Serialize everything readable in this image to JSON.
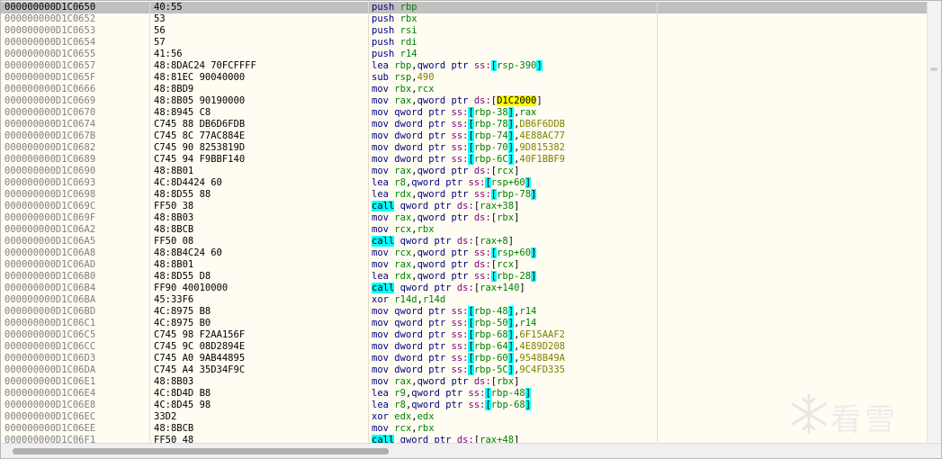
{
  "selected_index": 0,
  "rows": [
    {
      "addr": "000000000D1C0650",
      "bytes": "40:55",
      "mn": "push",
      "ops": [
        [
          "r",
          "rbp"
        ]
      ]
    },
    {
      "addr": "000000000D1C0652",
      "bytes": "53",
      "mn": "push",
      "ops": [
        [
          "r",
          "rbx"
        ]
      ]
    },
    {
      "addr": "000000000D1C0653",
      "bytes": "56",
      "mn": "push",
      "ops": [
        [
          "r",
          "rsi"
        ]
      ]
    },
    {
      "addr": "000000000D1C0654",
      "bytes": "57",
      "mn": "push",
      "ops": [
        [
          "r",
          "rdi"
        ]
      ]
    },
    {
      "addr": "000000000D1C0655",
      "bytes": "41:56",
      "mn": "push",
      "ops": [
        [
          "r",
          "r14"
        ]
      ]
    },
    {
      "addr": "000000000D1C0657",
      "bytes": "48:8DAC24 70FCFFFF",
      "mn": "lea",
      "ops": [
        [
          "r",
          "rbp"
        ],
        [
          "o",
          ","
        ],
        [
          "k",
          "qword ptr "
        ],
        [
          "s",
          "ss:"
        ],
        [
          "b",
          "["
        ],
        [
          "r",
          "rsp-390"
        ],
        [
          "b",
          "]"
        ]
      ]
    },
    {
      "addr": "000000000D1C065F",
      "bytes": "48:81EC 90040000",
      "mn": "sub",
      "ops": [
        [
          "r",
          "rsp"
        ],
        [
          "o",
          ","
        ],
        [
          "n",
          "490"
        ]
      ]
    },
    {
      "addr": "000000000D1C0666",
      "bytes": "48:8BD9",
      "mn": "mov",
      "ops": [
        [
          "r",
          "rbx"
        ],
        [
          "o",
          ","
        ],
        [
          "r",
          "rcx"
        ]
      ]
    },
    {
      "addr": "000000000D1C0669",
      "bytes": "48:8B05 90190000",
      "mn": "mov",
      "ops": [
        [
          "r",
          "rax"
        ],
        [
          "o",
          ","
        ],
        [
          "k",
          "qword ptr "
        ],
        [
          "s",
          "ds:"
        ],
        [
          "o",
          "["
        ],
        [
          "h",
          "D1C2000"
        ],
        [
          "o",
          "]"
        ]
      ]
    },
    {
      "addr": "000000000D1C0670",
      "bytes": "48:8945 C8",
      "mn": "mov",
      "ops": [
        [
          "k",
          "qword ptr "
        ],
        [
          "s",
          "ss:"
        ],
        [
          "b",
          "["
        ],
        [
          "r",
          "rbp-38"
        ],
        [
          "b",
          "]"
        ],
        [
          "o",
          ","
        ],
        [
          "r",
          "rax"
        ]
      ]
    },
    {
      "addr": "000000000D1C0674",
      "bytes": "C745 88 DB6D6FDB",
      "mn": "mov",
      "ops": [
        [
          "k",
          "dword ptr "
        ],
        [
          "s",
          "ss:"
        ],
        [
          "b",
          "["
        ],
        [
          "r",
          "rbp-78"
        ],
        [
          "b",
          "]"
        ],
        [
          "o",
          ","
        ],
        [
          "n",
          "DB6F6DDB"
        ]
      ]
    },
    {
      "addr": "000000000D1C067B",
      "bytes": "C745 8C 77AC884E",
      "mn": "mov",
      "ops": [
        [
          "k",
          "dword ptr "
        ],
        [
          "s",
          "ss:"
        ],
        [
          "b",
          "["
        ],
        [
          "r",
          "rbp-74"
        ],
        [
          "b",
          "]"
        ],
        [
          "o",
          ","
        ],
        [
          "n",
          "4E88AC77"
        ]
      ]
    },
    {
      "addr": "000000000D1C0682",
      "bytes": "C745 90 8253819D",
      "mn": "mov",
      "ops": [
        [
          "k",
          "dword ptr "
        ],
        [
          "s",
          "ss:"
        ],
        [
          "b",
          "["
        ],
        [
          "r",
          "rbp-70"
        ],
        [
          "b",
          "]"
        ],
        [
          "o",
          ","
        ],
        [
          "n",
          "9D815382"
        ]
      ]
    },
    {
      "addr": "000000000D1C0689",
      "bytes": "C745 94 F9BBF140",
      "mn": "mov",
      "ops": [
        [
          "k",
          "dword ptr "
        ],
        [
          "s",
          "ss:"
        ],
        [
          "b",
          "["
        ],
        [
          "r",
          "rbp-6C"
        ],
        [
          "b",
          "]"
        ],
        [
          "o",
          ","
        ],
        [
          "n",
          "40F1BBF9"
        ]
      ]
    },
    {
      "addr": "000000000D1C0690",
      "bytes": "48:8B01",
      "mn": "mov",
      "ops": [
        [
          "r",
          "rax"
        ],
        [
          "o",
          ","
        ],
        [
          "k",
          "qword ptr "
        ],
        [
          "s",
          "ds:"
        ],
        [
          "o",
          "["
        ],
        [
          "r",
          "rcx"
        ],
        [
          "o",
          "]"
        ]
      ]
    },
    {
      "addr": "000000000D1C0693",
      "bytes": "4C:8D4424 60",
      "mn": "lea",
      "ops": [
        [
          "r",
          "r8"
        ],
        [
          "o",
          ","
        ],
        [
          "k",
          "qword ptr "
        ],
        [
          "s",
          "ss:"
        ],
        [
          "b",
          "["
        ],
        [
          "r",
          "rsp+60"
        ],
        [
          "b",
          "]"
        ]
      ]
    },
    {
      "addr": "000000000D1C0698",
      "bytes": "48:8D55 88",
      "mn": "lea",
      "ops": [
        [
          "r",
          "rdx"
        ],
        [
          "o",
          ","
        ],
        [
          "k",
          "qword ptr "
        ],
        [
          "s",
          "ss:"
        ],
        [
          "b",
          "["
        ],
        [
          "r",
          "rbp-78"
        ],
        [
          "b",
          "]"
        ]
      ]
    },
    {
      "addr": "000000000D1C069C",
      "bytes": "FF50 38",
      "mn": "call",
      "ops": [
        [
          "k",
          "qword ptr "
        ],
        [
          "s",
          "ds:"
        ],
        [
          "o",
          "["
        ],
        [
          "r",
          "rax+38"
        ],
        [
          "o",
          "]"
        ]
      ]
    },
    {
      "addr": "000000000D1C069F",
      "bytes": "48:8B03",
      "mn": "mov",
      "ops": [
        [
          "r",
          "rax"
        ],
        [
          "o",
          ","
        ],
        [
          "k",
          "qword ptr "
        ],
        [
          "s",
          "ds:"
        ],
        [
          "o",
          "["
        ],
        [
          "r",
          "rbx"
        ],
        [
          "o",
          "]"
        ]
      ]
    },
    {
      "addr": "000000000D1C06A2",
      "bytes": "48:8BCB",
      "mn": "mov",
      "ops": [
        [
          "r",
          "rcx"
        ],
        [
          "o",
          ","
        ],
        [
          "r",
          "rbx"
        ]
      ]
    },
    {
      "addr": "000000000D1C06A5",
      "bytes": "FF50 08",
      "mn": "call",
      "ops": [
        [
          "k",
          "qword ptr "
        ],
        [
          "s",
          "ds:"
        ],
        [
          "o",
          "["
        ],
        [
          "r",
          "rax+8"
        ],
        [
          "o",
          "]"
        ]
      ]
    },
    {
      "addr": "000000000D1C06A8",
      "bytes": "48:8B4C24 60",
      "mn": "mov",
      "ops": [
        [
          "r",
          "rcx"
        ],
        [
          "o",
          ","
        ],
        [
          "k",
          "qword ptr "
        ],
        [
          "s",
          "ss:"
        ],
        [
          "b",
          "["
        ],
        [
          "r",
          "rsp+60"
        ],
        [
          "b",
          "]"
        ]
      ]
    },
    {
      "addr": "000000000D1C06AD",
      "bytes": "48:8B01",
      "mn": "mov",
      "ops": [
        [
          "r",
          "rax"
        ],
        [
          "o",
          ","
        ],
        [
          "k",
          "qword ptr "
        ],
        [
          "s",
          "ds:"
        ],
        [
          "o",
          "["
        ],
        [
          "r",
          "rcx"
        ],
        [
          "o",
          "]"
        ]
      ]
    },
    {
      "addr": "000000000D1C06B0",
      "bytes": "48:8D55 D8",
      "mn": "lea",
      "ops": [
        [
          "r",
          "rdx"
        ],
        [
          "o",
          ","
        ],
        [
          "k",
          "qword ptr "
        ],
        [
          "s",
          "ss:"
        ],
        [
          "b",
          "["
        ],
        [
          "r",
          "rbp-28"
        ],
        [
          "b",
          "]"
        ]
      ]
    },
    {
      "addr": "000000000D1C06B4",
      "bytes": "FF90 40010000",
      "mn": "call",
      "ops": [
        [
          "k",
          "qword ptr "
        ],
        [
          "s",
          "ds:"
        ],
        [
          "o",
          "["
        ],
        [
          "r",
          "rax+140"
        ],
        [
          "o",
          "]"
        ]
      ]
    },
    {
      "addr": "000000000D1C06BA",
      "bytes": "45:33F6",
      "mn": "xor",
      "ops": [
        [
          "r",
          "r14d"
        ],
        [
          "o",
          ","
        ],
        [
          "r",
          "r14d"
        ]
      ]
    },
    {
      "addr": "000000000D1C06BD",
      "bytes": "4C:8975 B8",
      "mn": "mov",
      "ops": [
        [
          "k",
          "qword ptr "
        ],
        [
          "s",
          "ss:"
        ],
        [
          "b",
          "["
        ],
        [
          "r",
          "rbp-48"
        ],
        [
          "b",
          "]"
        ],
        [
          "o",
          ","
        ],
        [
          "r",
          "r14"
        ]
      ]
    },
    {
      "addr": "000000000D1C06C1",
      "bytes": "4C:8975 B0",
      "mn": "mov",
      "ops": [
        [
          "k",
          "qword ptr "
        ],
        [
          "s",
          "ss:"
        ],
        [
          "b",
          "["
        ],
        [
          "r",
          "rbp-50"
        ],
        [
          "b",
          "]"
        ],
        [
          "o",
          ","
        ],
        [
          "r",
          "r14"
        ]
      ]
    },
    {
      "addr": "000000000D1C06C5",
      "bytes": "C745 98 F2AA156F",
      "mn": "mov",
      "ops": [
        [
          "k",
          "dword ptr "
        ],
        [
          "s",
          "ss:"
        ],
        [
          "b",
          "["
        ],
        [
          "r",
          "rbp-68"
        ],
        [
          "b",
          "]"
        ],
        [
          "o",
          ","
        ],
        [
          "n",
          "6F15AAF2"
        ]
      ]
    },
    {
      "addr": "000000000D1C06CC",
      "bytes": "C745 9C 08D2894E",
      "mn": "mov",
      "ops": [
        [
          "k",
          "dword ptr "
        ],
        [
          "s",
          "ss:"
        ],
        [
          "b",
          "["
        ],
        [
          "r",
          "rbp-64"
        ],
        [
          "b",
          "]"
        ],
        [
          "o",
          ","
        ],
        [
          "n",
          "4E89D208"
        ]
      ]
    },
    {
      "addr": "000000000D1C06D3",
      "bytes": "C745 A0 9AB44895",
      "mn": "mov",
      "ops": [
        [
          "k",
          "dword ptr "
        ],
        [
          "s",
          "ss:"
        ],
        [
          "b",
          "["
        ],
        [
          "r",
          "rbp-60"
        ],
        [
          "b",
          "]"
        ],
        [
          "o",
          ","
        ],
        [
          "n",
          "9548B49A"
        ]
      ]
    },
    {
      "addr": "000000000D1C06DA",
      "bytes": "C745 A4 35D34F9C",
      "mn": "mov",
      "ops": [
        [
          "k",
          "dword ptr "
        ],
        [
          "s",
          "ss:"
        ],
        [
          "b",
          "["
        ],
        [
          "r",
          "rbp-5C"
        ],
        [
          "b",
          "]"
        ],
        [
          "o",
          ","
        ],
        [
          "n",
          "9C4FD335"
        ]
      ]
    },
    {
      "addr": "000000000D1C06E1",
      "bytes": "48:8B03",
      "mn": "mov",
      "ops": [
        [
          "r",
          "rax"
        ],
        [
          "o",
          ","
        ],
        [
          "k",
          "qword ptr "
        ],
        [
          "s",
          "ds:"
        ],
        [
          "o",
          "["
        ],
        [
          "r",
          "rbx"
        ],
        [
          "o",
          "]"
        ]
      ]
    },
    {
      "addr": "000000000D1C06E4",
      "bytes": "4C:8D4D B8",
      "mn": "lea",
      "ops": [
        [
          "r",
          "r9"
        ],
        [
          "o",
          ","
        ],
        [
          "k",
          "qword ptr "
        ],
        [
          "s",
          "ss:"
        ],
        [
          "b",
          "["
        ],
        [
          "r",
          "rbp-48"
        ],
        [
          "b",
          "]"
        ]
      ]
    },
    {
      "addr": "000000000D1C06E8",
      "bytes": "4C:8D45 98",
      "mn": "lea",
      "ops": [
        [
          "r",
          "r8"
        ],
        [
          "o",
          ","
        ],
        [
          "k",
          "qword ptr "
        ],
        [
          "s",
          "ss:"
        ],
        [
          "b",
          "["
        ],
        [
          "r",
          "rbp-68"
        ],
        [
          "b",
          "]"
        ]
      ]
    },
    {
      "addr": "000000000D1C06EC",
      "bytes": "33D2",
      "mn": "xor",
      "ops": [
        [
          "r",
          "edx"
        ],
        [
          "o",
          ","
        ],
        [
          "r",
          "edx"
        ]
      ]
    },
    {
      "addr": "000000000D1C06EE",
      "bytes": "48:8BCB",
      "mn": "mov",
      "ops": [
        [
          "r",
          "rcx"
        ],
        [
          "o",
          ","
        ],
        [
          "r",
          "rbx"
        ]
      ]
    },
    {
      "addr": "000000000D1C06F1",
      "bytes": "FF50 48",
      "mn": "call",
      "ops": [
        [
          "k",
          "qword ptr "
        ],
        [
          "s",
          "ds:"
        ],
        [
          "o",
          "["
        ],
        [
          "r",
          "rax+48"
        ],
        [
          "o",
          "]"
        ]
      ]
    }
  ],
  "watermark": {
    "text": "看雪",
    "logo_icon": "snowflake-logo-icon"
  },
  "colors": {
    "background": "#fffcf2",
    "selected_row": "#c0c0c0",
    "address": "#808080",
    "register": "#008000",
    "keyword": "#000080",
    "segment": "#800080",
    "number": "#808000",
    "call_highlight": "#00ffff",
    "address_highlight": "#ffff00"
  }
}
